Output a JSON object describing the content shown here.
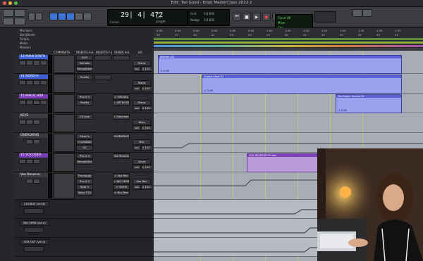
{
  "window": {
    "title": "Edit: Too Good - Knob MasterClass 2022 2"
  },
  "colors": {
    "accent": "#3b76d8",
    "clip": "#9aa2f0",
    "clip_header": "#5a61d6",
    "track_blue": "#3f5fd6",
    "track_purple": "#7a3fb8"
  },
  "counter": {
    "main": "29| 4| 472",
    "sub_label": "Cursor",
    "start_label": "Start",
    "end_label": "End",
    "length_label": "Length"
  },
  "counter2": {
    "nudge_label": "Nudge",
    "grid_label": "Grid",
    "val1": "0|1|000",
    "val2": "0|1|000"
  },
  "lcd": {
    "line1": "Cloud OK",
    "line2": "Mixer",
    "line3": "Cpu"
  },
  "ruler": {
    "rows": [
      "Min:Secs",
      "Bars|Beats",
      "Tempo",
      "Meter",
      "Markers"
    ],
    "ticks": [
      "0:30",
      "0:35",
      "0:40",
      "0:45",
      "0:50",
      "0:55",
      "1:00",
      "1:05",
      "1:10",
      "1:15",
      "1:20",
      "1:25",
      "1:30",
      "1:35"
    ],
    "bar_ticks": [
      "15",
      "17",
      "19",
      "21",
      "23",
      "25",
      "27",
      "29",
      "31",
      "33",
      "35",
      "37",
      "39",
      "41"
    ]
  },
  "columns": {
    "comments": "COMMENTS",
    "inserts_ae": "INSERTS A-E",
    "inserts_fj": "INSERTS F-J",
    "sends_ae": "SENDS A-E",
    "io": "I/O"
  },
  "tracks": [
    {
      "name": "13 MAIN SYNTH",
      "inserts": [
        "EQ3",
        "Valhalla",
        "Decapitator"
      ],
      "sends": [
        "",
        ""
      ],
      "io": [
        "Piano",
        ""
      ],
      "vol": "vol",
      "pan": "< 100  100 >",
      "color": "#3f5fd6"
    },
    {
      "name": "14 NORD-H",
      "inserts": [
        "",
        "ProMix",
        ""
      ],
      "sends": [
        "",
        ""
      ],
      "io": [
        "Piano",
        ""
      ],
      "vol": "vol",
      "pan": "< 100  100 >",
      "color": "#3f5fd6"
    },
    {
      "name": "15 MAGIC ARP",
      "inserts": [
        "Pro-Q 3",
        "ProMix",
        ""
      ],
      "sends": [
        "> SPECIAL",
        "> ARTNOISE"
      ],
      "io": [
        "Piano",
        ""
      ],
      "vol": "vol",
      "pan": "< 100  100 >",
      "color": "#7a3fb8"
    },
    {
      "name": "KEYS",
      "inserts": [
        "CS-Link",
        "",
        ""
      ],
      "sends": [
        "> Sidechain",
        ""
      ],
      "io": [
        "Keys",
        ""
      ],
      "vol": "vol",
      "pan": "< 100  100 >",
      "color": "#3a3c40"
    },
    {
      "name": "OVERDRIVE",
      "inserts": [
        "FilterFx",
        "CrystalBot",
        "OK"
      ],
      "sends": [
        "OVERDRIVE",
        ""
      ],
      "io": [
        "Bus",
        ""
      ],
      "vol": "vol",
      "pan": "< 100  100 >",
      "color": "#3a3c40"
    },
    {
      "name": "15 VOCODER",
      "inserts": [
        "Pro-Q 3",
        "Decapitator",
        ""
      ],
      "sends": [
        "Vox Reverse",
        ""
      ],
      "io": [
        "Vocal",
        ""
      ],
      "vol": "vol",
      "pan": "< 100  100 >",
      "color": "#7a3fb8"
    },
    {
      "name": "Vox Reverse",
      "inserts": [
        "Transtube",
        "Pro-Q 3",
        "Spat 5",
        "Warp P18"
      ],
      "sends": [
        "> Vox Rev",
        "> BIG VERB",
        "> HARM",
        "> Bus Rev"
      ],
      "io": [
        "Vox Rev",
        ""
      ],
      "vol": "vol",
      "pan": "< 100  100 >",
      "color": "#3a3c40"
    }
  ],
  "sub_tracks": [
    {
      "name": "CHORUS (vol d)"
    },
    {
      "name": "BIG VERB (vol d)"
    },
    {
      "name": "VOX OUT (vol d)"
    }
  ],
  "clips": [
    {
      "name": "Wooden-01",
      "db": "-5.0 dB"
    },
    {
      "name": "Choice Sleet-01",
      "db": "-4.3 dB"
    },
    {
      "name": "Eed Magic Scored-01",
      "db": "-4.0 dB"
    },
    {
      "name": "VOX REVERSE-01.wav",
      "db": ""
    }
  ],
  "video": {
    "description_alt": "instructor webcam"
  }
}
